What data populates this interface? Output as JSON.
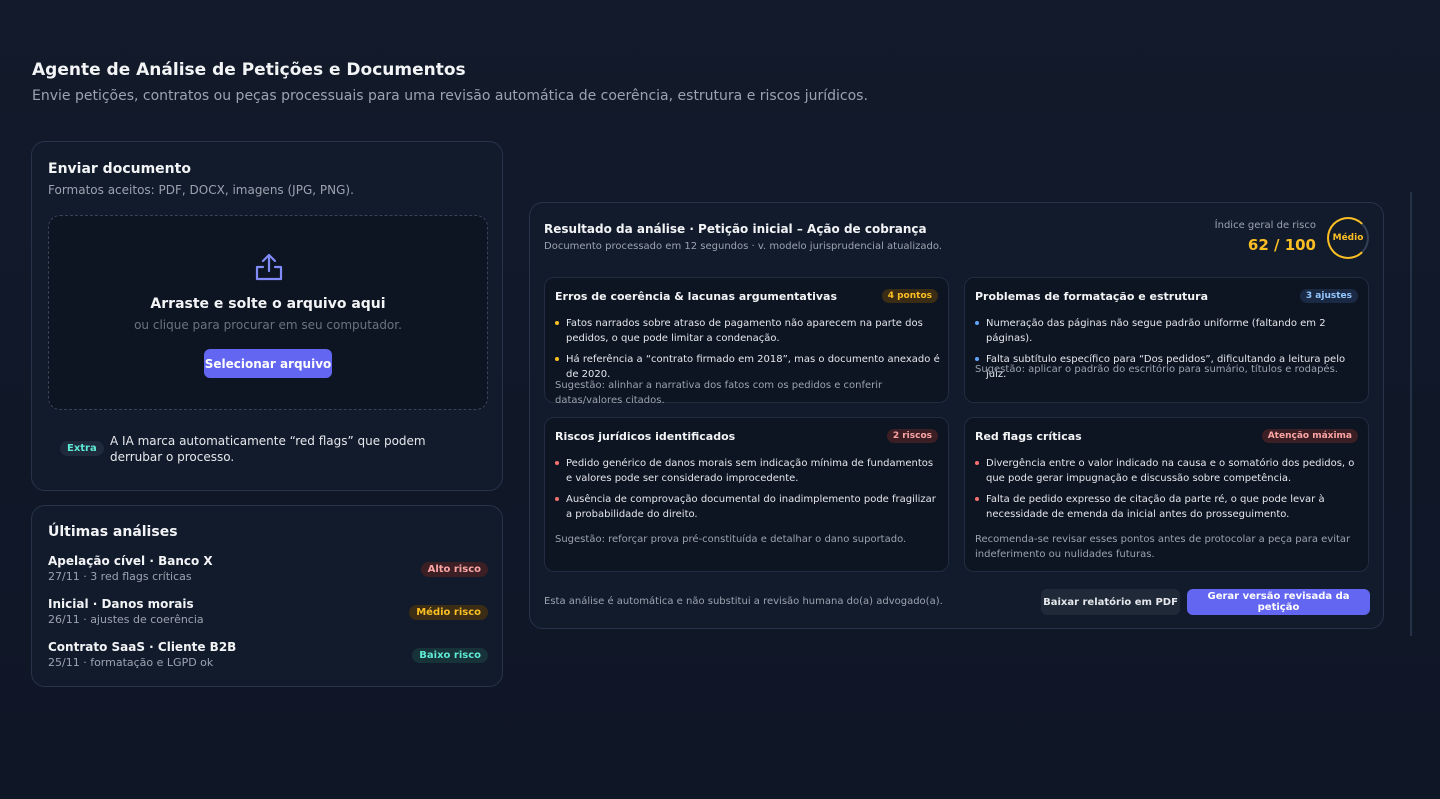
{
  "header": {
    "title": "Agente de Análise de Petições e Documentos",
    "subtitle": "Envie petições, contratos ou peças processuais para uma revisão automática de coerência, estrutura e riscos jurídicos."
  },
  "upload": {
    "title": "Enviar documento",
    "formats": "Formatos aceitos: PDF, DOCX, imagens (JPG, PNG).",
    "icon": "upload-icon",
    "drop_title": "Arraste e solte o arquivo aqui",
    "drop_hint": "ou clique para procurar em seu computador.",
    "button": "Selecionar arquivo",
    "extra_badge": "Extra",
    "extra_text": "A IA marca automaticamente “red flags” que podem derrubar o processo."
  },
  "recent": {
    "title": "Últimas análises",
    "items": [
      {
        "name": "Apelação cível · Banco X",
        "meta": "27/11 · 3 red flags críticas",
        "badge": "Alto risco"
      },
      {
        "name": "Inicial · Danos morais",
        "meta": "26/11 · ajustes de coerência",
        "badge": "Médio risco"
      },
      {
        "name": "Contrato SaaS · Cliente B2B",
        "meta": "25/11 · formatação e LGPD ok",
        "badge": "Baixo risco"
      }
    ]
  },
  "result": {
    "title": "Resultado da análise · Petição inicial – Ação de cobrança",
    "subtitle": "Documento processado em 12 segundos · v. modelo jurisprudencial atualizado.",
    "risk_label": "Índice geral de risco",
    "risk_score": "62 / 100",
    "risk_level": "Médio",
    "risk_value": 0.62,
    "panels": {
      "coherence": {
        "title": "Erros de coerência & lacunas argumentativas",
        "badge": "4 pontos",
        "items": [
          "Fatos narrados sobre atraso de pagamento não aparecem na parte dos pedidos, o que pode limitar a condenação.",
          "Há referência a “contrato firmado em 2018”, mas o documento anexado é de 2020."
        ],
        "hint": "Sugestão: alinhar a narrativa dos fatos com os pedidos e conferir datas/valores citados."
      },
      "formatting": {
        "title": "Problemas de formatação e estrutura",
        "badge": "3 ajustes",
        "items": [
          "Numeração das páginas não segue padrão uniforme (faltando em 2 páginas).",
          "Falta subtítulo específico para “Dos pedidos”, dificultando a leitura pelo juiz."
        ],
        "hint": "Sugestão: aplicar o padrão do escritório para sumário, títulos e rodapés."
      },
      "risks": {
        "title": "Riscos jurídicos identificados",
        "badge": "2 riscos",
        "items": [
          "Pedido genérico de danos morais sem indicação mínima de fundamentos e valores pode ser considerado improcedente.",
          "Ausência de comprovação documental do inadimplemento pode fragilizar a probabilidade do direito."
        ],
        "hint": "Sugestão: reforçar prova pré-constituída e detalhar o dano suportado."
      },
      "redflags": {
        "title": "Red flags críticas",
        "badge": "Atenção máxima",
        "items": [
          "Divergência entre o valor indicado na causa e o somatório dos pedidos, o que pode gerar impugnação e discussão sobre competência.",
          "Falta de pedido expresso de citação da parte ré, o que pode levar à necessidade de emenda da inicial antes do prosseguimento."
        ],
        "hint": "Recomenda-se revisar esses pontos antes de protocolar a peça para evitar indeferimento ou nulidades futuras."
      }
    },
    "disclaimer": "Esta análise é automática e não substitui a revisão humana do(a) advogado(a).",
    "pdf_button": "Baixar relatório em PDF",
    "revise_button": "Gerar versão revisada da petição"
  },
  "colors": {
    "accent": "#6366f1",
    "high_risk": "#fca5a5",
    "medium_risk": "#fbbf24",
    "low_risk": "#5eead4",
    "info": "#60a5fa"
  }
}
